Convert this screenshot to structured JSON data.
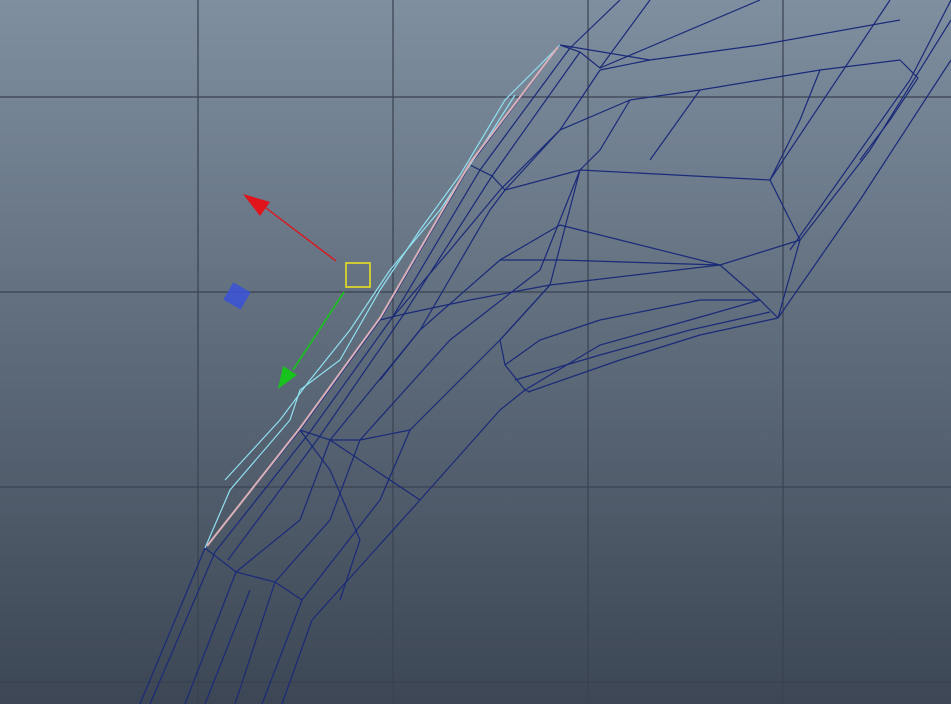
{
  "viewport": {
    "background_top": "#7f8fa0",
    "background_bottom": "#3c4654",
    "grid_color": "#3a4250"
  },
  "mesh": {
    "wire_color": "#1a2a78",
    "selection_highlight_color": "#8fe0f0",
    "selected_edge_color": "#d9b0b8"
  },
  "manipulator": {
    "tool": "move",
    "x_axis_color": "#e0141a",
    "y_axis_color": "#18c21c",
    "z_axis_color": "#3a52d8",
    "center_handle_color": "#e8e020"
  }
}
